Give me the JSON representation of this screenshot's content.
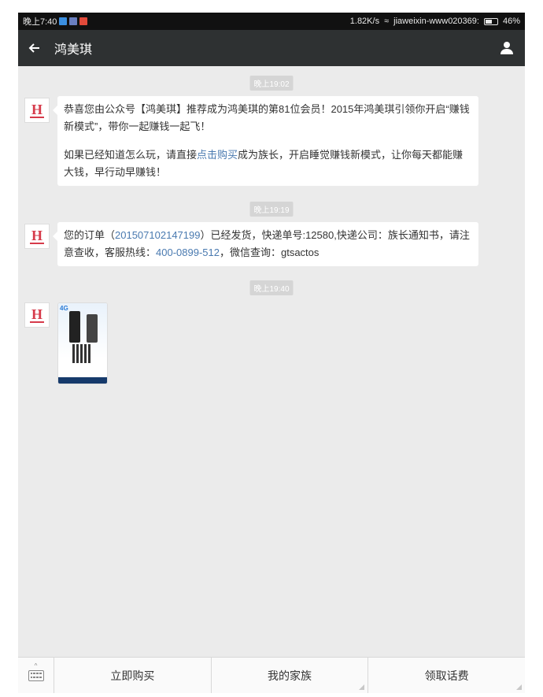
{
  "statusbar": {
    "time": "晚上7:40",
    "speed": "1.82K/s",
    "account": "jiaweixin-www020369:",
    "battery": "46%"
  },
  "header": {
    "title": "鸿美琪",
    "back_icon": "back-arrow-icon",
    "profile_icon": "person-icon"
  },
  "messages": [
    {
      "timestamp": "晚上19:02",
      "p1": "恭喜您由公众号【鸿美琪】推荐成为鸿美琪的第81位会员！2015年鸿美琪引领你开启“赚钱新模式”，带你一起赚钱一起飞！",
      "p2_before": "如果已经知道怎么玩，请直接",
      "p2_link": "点击购买",
      "p2_after": "成为族长，开启睡觉赚钱新模式，让你每天都能赚大钱，早行动早赚钱！"
    },
    {
      "timestamp": "晚上19:19",
      "t1": "您的订单（",
      "order_no": "201507102147199",
      "t2": "）已经发货，快递单号:12580,快递公司：族长通知书，请注意查收，客服热线：",
      "phone": "400-0899-512",
      "t3": "，微信查询：gtsactos"
    },
    {
      "timestamp": "晚上19:40",
      "image_badge": "4G"
    }
  ],
  "avatar_letter": "H",
  "bottom_menu": {
    "keyboard_icon": "keyboard-icon",
    "items": [
      {
        "label": "立即购买"
      },
      {
        "label": "我的家族"
      },
      {
        "label": "领取话费"
      }
    ]
  },
  "colors": {
    "titlebar": "#2e3132",
    "chat_bg": "#ebebeb",
    "link": "#4a7ab0",
    "brand": "#d63a4a"
  }
}
